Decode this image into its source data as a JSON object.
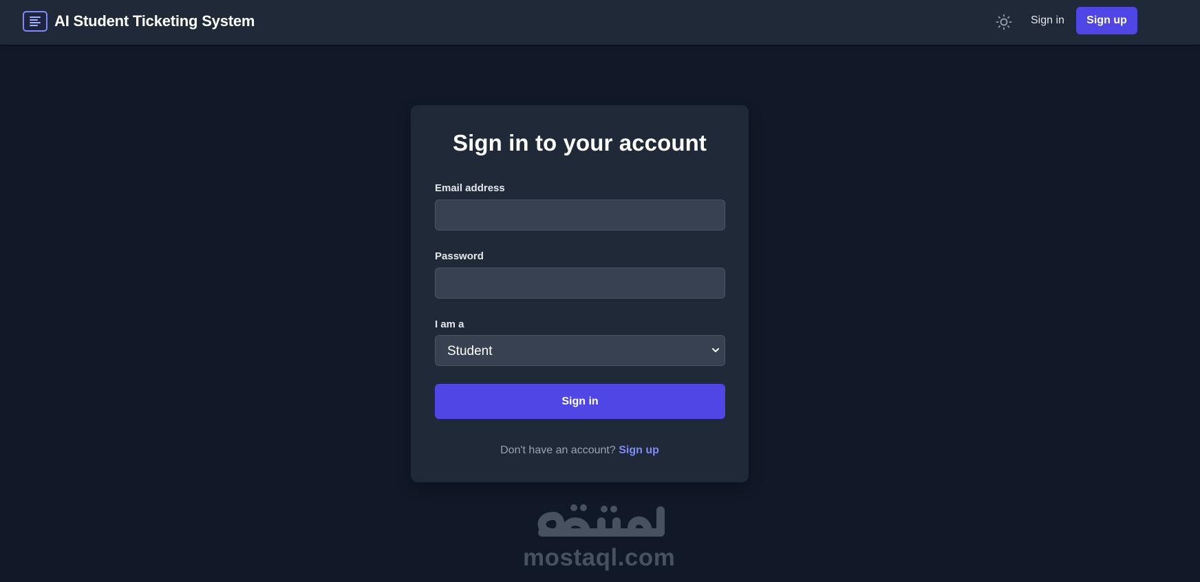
{
  "app": {
    "title": "AI Student Ticketing System",
    "logo_icon": "menu-lines-icon"
  },
  "header": {
    "theme_toggle_icon": "sun-icon",
    "signin_label": "Sign in",
    "signup_label": "Sign up"
  },
  "login": {
    "title": "Sign in to your account",
    "email_label": "Email address",
    "email_value": "",
    "password_label": "Password",
    "password_value": "",
    "role_label": "I am a",
    "role_selected": "Student",
    "submit_label": "Sign in",
    "footer_prompt": "Don't have an account?",
    "footer_link": "Sign up"
  },
  "watermark": {
    "arabic_text": "مستقل",
    "site_text": "mostaql.com"
  },
  "colors": {
    "page_background": "#111827",
    "surface": "#1f2937",
    "input_background": "#374151",
    "accent": "#4f46e5",
    "accent_light": "#818cf8",
    "muted_text": "#9ca3af"
  }
}
